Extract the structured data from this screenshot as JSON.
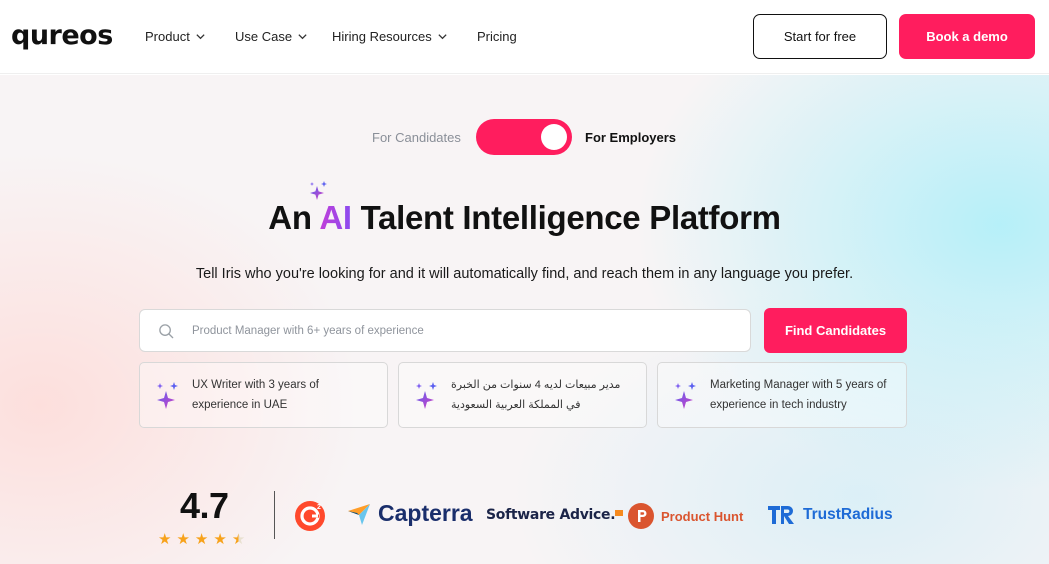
{
  "nav": {
    "logo": "qureos",
    "items": [
      {
        "label": "Product",
        "has_dropdown": true
      },
      {
        "label": "Use Case",
        "has_dropdown": true
      },
      {
        "label": "Hiring Resources",
        "has_dropdown": true
      },
      {
        "label": "Pricing",
        "has_dropdown": false
      }
    ],
    "start_free": "Start for free",
    "book_demo": "Book a demo"
  },
  "toggle": {
    "left_label": "For Candidates",
    "right_label": "For Employers",
    "active": "For Employers"
  },
  "hero": {
    "title_before": "An ",
    "title_ai": "AI",
    "title_after": " Talent Intelligence Platform",
    "subtitle": "Tell Iris who you're looking for and it will automatically find, and reach them in any language you prefer."
  },
  "search": {
    "placeholder": "Product Manager with 6+ years of experience",
    "value": "",
    "button": "Find Candidates"
  },
  "suggestions": [
    {
      "text": "UX Writer with 3 years of experience in UAE"
    },
    {
      "text": "مدير مبيعات لديه 4 سنوات من الخبرة في المملكة العربية السعودية"
    },
    {
      "text": "Marketing Manager with 5 years of experience in tech industry"
    }
  ],
  "rating": {
    "score": "4.7",
    "stars": 4.5
  },
  "brands": {
    "g2": "G2",
    "capterra": "Capterra",
    "software_advice": "Software Advice.",
    "product_hunt": "Product Hunt",
    "trustradius": "TrustRadius"
  },
  "colors": {
    "accent": "#ff1d5e",
    "stars": "#f7a21b",
    "ai_gradient_start": "#c23fd8",
    "ai_gradient_end": "#8a4bf0"
  },
  "icons": [
    "chevron-down-icon",
    "search-icon",
    "sparkle-icon",
    "star-icon",
    "g2-logo",
    "capterra-logo",
    "software-advice-logo",
    "product-hunt-logo",
    "trustradius-logo"
  ]
}
